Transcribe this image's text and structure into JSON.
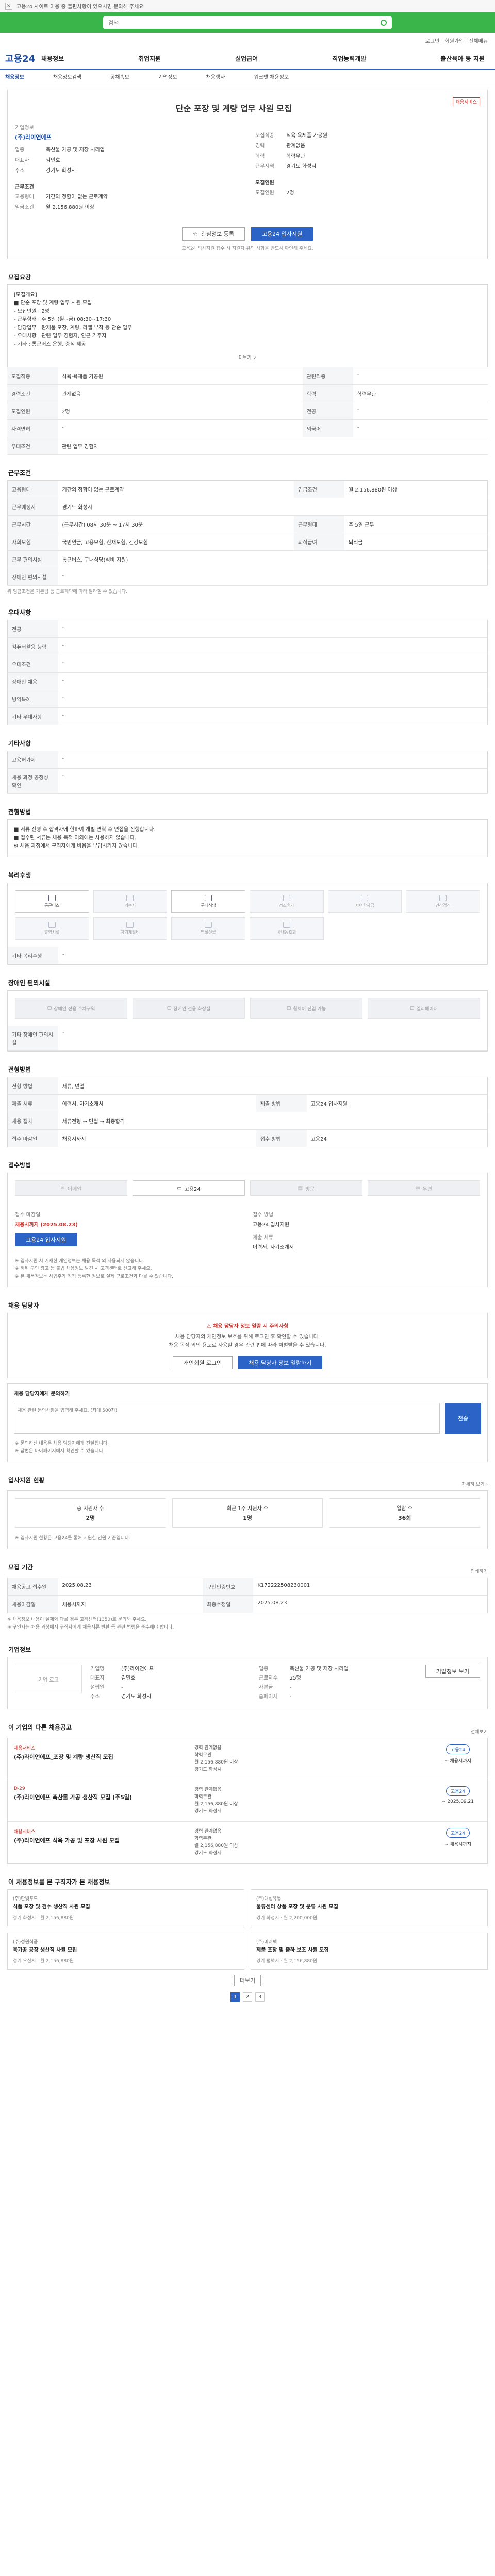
{
  "topbar": {
    "close": "×",
    "notice": "고용24 사이트 이용 중 불편사항이 있으시면 문의해 주세요"
  },
  "search": {
    "placeholder": "검색",
    "button": "검색"
  },
  "utility": [
    "로그인",
    "회원가입",
    "전체메뉴"
  ],
  "brand": "고용24",
  "gnb": [
    "채용정보",
    "취업지원",
    "실업급여",
    "직업능력개발",
    "출산육아 등 지원"
  ],
  "lnb": [
    "채용정보",
    "채용정보검색",
    "공채속보",
    "기업정보",
    "채용행사",
    "워크넷 채용정보"
  ],
  "job": {
    "badge": "채용서비스",
    "title": "단순 포장 및 계량 업무 사원 모집",
    "company_label": "기업정보",
    "company_name": "(주)라이언에프",
    "left": [
      {
        "k": "업종",
        "v": "축산물 가공 및 저장 처리업"
      },
      {
        "k": "대표자",
        "v": "김민호"
      },
      {
        "k": "주소",
        "v": "경기도 화성시"
      }
    ],
    "right": [
      {
        "k": "모집직종",
        "v": "식육·육제품 가공원"
      },
      {
        "k": "경력",
        "v": "관계없음"
      },
      {
        "k": "학력",
        "v": "학력무관"
      },
      {
        "k": "근무지역",
        "v": "경기도 화성시"
      }
    ],
    "cond_label": "근무조건",
    "cond": [
      {
        "k": "고용형태",
        "v": "기간의 정함이 없는 근로계약"
      },
      {
        "k": "임금조건",
        "v": "월 2,156,880원 이상"
      }
    ],
    "hire_label": "모집인원",
    "hire": [
      {
        "k": "모집인원",
        "v": "2명"
      }
    ],
    "btn_save": "관심정보 등록",
    "btn_apply": "고용24 입사지원",
    "apply_note": "고용24 입사지원 접수 시 지원자 유의 사항을 반드시 확인해 주세요."
  },
  "detail": {
    "title": "모집요강",
    "desc": [
      "[모집개요]",
      "■ 단순 포장 및 계량 업무 사원 모집",
      "- 모집인원 : 2명",
      "- 근무형태 : 주 5일 (월~금) 08:30~17:30",
      "- 담당업무 : 완제품 포장, 계량, 라벨 부착 등 단순 업무",
      "- 우대사항 : 관련 업무 경험자, 인근 거주자",
      "- 기타 : 통근버스 운행, 중식 제공"
    ],
    "more": "더보기 ∨",
    "rows": [
      {
        "k": "모집직종",
        "v": "식육·육제품 가공원",
        "k2": "관련직종",
        "v2": "-"
      },
      {
        "k": "경력조건",
        "v": "관계없음",
        "k2": "학력",
        "v2": "학력무관"
      },
      {
        "k": "모집인원",
        "v": "2명",
        "k2": "전공",
        "v2": "-"
      },
      {
        "k": "자격면허",
        "v": "-",
        "k2": "외국어",
        "v2": "-"
      },
      {
        "k": "우대조건",
        "v": "관련 업무 경험자",
        "k2": "",
        "v2": ""
      }
    ]
  },
  "work": {
    "title": "근무조건",
    "rows": [
      {
        "k": "고용형태",
        "v": "기간의 정함이 없는 근로계약",
        "k2": "임금조건",
        "v2": "월 2,156,880원 이상"
      },
      {
        "k": "근무예정지",
        "v": "경기도 화성시",
        "k2": "",
        "v2": ""
      },
      {
        "k": "근무시간",
        "v": "(근무시간) 08시 30분 ~ 17시 30분",
        "k2": "근무형태",
        "v2": "주 5일 근무"
      },
      {
        "k": "사회보험",
        "v": "국민연금, 고용보험, 산재보험, 건강보험",
        "k2": "퇴직급여",
        "v2": "퇴직금"
      },
      {
        "k": "근무 편의시설",
        "v": "통근버스, 구내식당(식비 지원)",
        "k2": "",
        "v2": ""
      },
      {
        "k": "장애인 편의시설",
        "v": "-",
        "k2": "",
        "v2": ""
      }
    ],
    "note": "위 임금조건은 기본급 등 근로계약에 따라 달라질 수 있습니다."
  },
  "welfare": {
    "title": "우대사항",
    "rows": [
      {
        "k": "전공",
        "v": "-"
      },
      {
        "k": "컴퓨터활용 능력",
        "v": "-"
      },
      {
        "k": "우대조건",
        "v": "-"
      },
      {
        "k": "장애인 채용",
        "v": "-"
      },
      {
        "k": "병역특례",
        "v": "-"
      },
      {
        "k": "기타 우대사항",
        "v": "-"
      }
    ]
  },
  "etc": {
    "title": "기타사항",
    "rows": [
      {
        "k": "고용허가제",
        "v": "-"
      },
      {
        "k": "채용 과정 공정성 확인",
        "v": "-"
      }
    ]
  },
  "process": {
    "title": "전형방법",
    "text": [
      "■ 서류 전형 후 합격자에 한하여 개별 연락 후 면접을 진행합니다.",
      "■ 접수된 서류는 채용 목적 이외에는 사용하지 않습니다.",
      "※ 채용 과정에서 구직자에게 비용을 부담시키지 않습니다."
    ]
  },
  "benefits": {
    "title": "복리후생",
    "items": [
      {
        "label": "통근버스",
        "on": true
      },
      {
        "label": "기숙사",
        "on": false
      },
      {
        "label": "구내식당",
        "on": true
      },
      {
        "label": "경조휴가",
        "on": false
      },
      {
        "label": "자녀학자금",
        "on": false
      },
      {
        "label": "건강검진",
        "on": false
      },
      {
        "label": "휴양시설",
        "on": false
      },
      {
        "label": "자기계발비",
        "on": false
      },
      {
        "label": "명절선물",
        "on": false
      },
      {
        "label": "사내동호회",
        "on": false
      }
    ],
    "other_k": "기타 복리후생",
    "other_v": "-"
  },
  "disability": {
    "title": "장애인 편의시설",
    "items": [
      "장애인 전용 주차구역",
      "장애인 전용 화장실",
      "휠체어 진입 가능",
      "엘리베이터"
    ],
    "other_k": "기타 장애인 편의시설",
    "other_v": "-"
  },
  "worktype": {
    "title": "전형방법",
    "rows": [
      {
        "k": "전형 방법",
        "v": "서류, 면접",
        "k2": "",
        "v2": ""
      },
      {
        "k": "제출 서류",
        "v": "이력서, 자기소개서",
        "k2": "제출 방법",
        "v2": "고용24 입사지원"
      },
      {
        "k": "채용 절차",
        "v": "서류전형 → 면접 → 최종합격",
        "k2": "",
        "v2": ""
      },
      {
        "k": "접수 마감일",
        "v": "채용시까지",
        "k2": "접수 방법",
        "v2": "고용24"
      }
    ]
  },
  "apply_method": {
    "title": "접수방법",
    "items": [
      {
        "label": "이메일",
        "on": false
      },
      {
        "label": "고용24",
        "on": true
      },
      {
        "label": "방문",
        "on": false
      },
      {
        "label": "우편",
        "on": false
      }
    ]
  },
  "apply_info": {
    "k1": "접수 마감일",
    "v1": "채용시까지 (2025.08.23)",
    "btn": "고용24 입사지원",
    "k2": "접수 방법",
    "v2": "고용24 입사지원",
    "k3": "제출 서류",
    "v3": "이력서, 자기소개서",
    "notes": [
      "※ 입사지원 시 기재한 개인정보는 채용 목적 외 사용되지 않습니다.",
      "※ 허위 구인 광고 등 불법 채용정보 발견 시 고객센터로 신고해 주세요.",
      "※ 본 채용정보는 사업주가 직접 등록한 정보로 실제 근로조건과 다를 수 있습니다."
    ]
  },
  "contact": {
    "title": "채용 담당자",
    "warn": "채용 담당자 정보 열람 시 주의사항",
    "text": [
      "채용 담당자의 개인정보 보호를 위해 로그인 후 확인할 수 있습니다.",
      "채용 목적 외의 용도로 사용할 경우 관련 법에 따라 처벌받을 수 있습니다."
    ],
    "btn1": "개인회원 로그인",
    "btn2": "채용 담당자 정보 열람하기"
  },
  "inquiry": {
    "label": "채용 담당자에게 문의하기",
    "placeholder": "채용 관련 문의사항을 입력해 주세요. (최대 500자)",
    "send": "전송",
    "notes": [
      "※ 문의하신 내용은 채용 담당자에게 전달됩니다.",
      "※ 답변은 마이페이지에서 확인할 수 있습니다."
    ]
  },
  "stats": {
    "title": "입사지원 현황",
    "aside": "자세히 보기 ›",
    "items": [
      {
        "k": "총 지원자 수",
        "v": "2명"
      },
      {
        "k": "최근 1주 지원자 수",
        "v": "1명"
      },
      {
        "k": "열람 수",
        "v": "36회"
      }
    ],
    "note": "※ 입사지원 현황은 고용24를 통해 지원한 인원 기준입니다."
  },
  "period": {
    "title": "모집 기간",
    "aside": "인쇄하기",
    "rows": [
      {
        "k": "채용공고 접수일",
        "v": "2025.08.23",
        "k2": "구인인증번호",
        "v2": "K172222508230001"
      },
      {
        "k": "채용마감일",
        "v": "채용시까지",
        "k2": "최종수정일",
        "v2": "2025.08.23"
      }
    ],
    "notes": [
      "※ 채용정보 내용이 실제와 다를 경우 고객센터(1350)로 문의해 주세요.",
      "※ 구인자는 채용 과정에서 구직자에게 채용서류 반환 등 관련 법령을 준수해야 합니다."
    ]
  },
  "company": {
    "title": "기업정보",
    "logo": "기업 로고",
    "rows": [
      {
        "k": "기업명",
        "v": "(주)라이언에프"
      },
      {
        "k": "업종",
        "v": "축산물 가공 및 저장 처리업"
      },
      {
        "k": "대표자",
        "v": "김민호"
      },
      {
        "k": "근로자수",
        "v": "25명"
      },
      {
        "k": "설립일",
        "v": "-"
      },
      {
        "k": "자본금",
        "v": "-"
      },
      {
        "k": "주소",
        "v": "경기도 화성시"
      },
      {
        "k": "홈페이지",
        "v": "-"
      }
    ],
    "btn": "기업정보 보기"
  },
  "related": {
    "title": "이 기업의 다른 채용공고",
    "aside": "전체보기",
    "items": [
      {
        "tag": "채용서비스",
        "title": "(주)라이언에프_포장 및 계량 생산직 모집",
        "lines": [
          "경력 관계없음",
          "학력무관",
          "월 2,156,880원 이상",
          "경기도 화성시"
        ],
        "pill": "고용24",
        "date": "~ 채용시까지"
      },
      {
        "tag": "D-29",
        "title": "(주)라이언에프 축산물 가공 생산직 모집 (주5일)",
        "lines": [
          "경력 관계없음",
          "학력무관",
          "월 2,156,880원 이상",
          "경기도 화성시"
        ],
        "pill": "고용24",
        "date": "~ 2025.09.21"
      },
      {
        "tag": "채용서비스",
        "title": "(주)라이언에프 식육 가공 및 포장 사원 모집",
        "lines": [
          "경력 관계없음",
          "학력무관",
          "월 2,156,880원 이상",
          "경기도 화성시"
        ],
        "pill": "고용24",
        "date": "~ 채용시까지"
      }
    ]
  },
  "recommend": {
    "title": "이 채용정보를 본 구직자가 본 채용정보",
    "cards": [
      {
        "co": "(주)한빛푸드",
        "t": "식품 포장 및 검수 생산직 사원 모집",
        "m": "경기 화성시 · 월 2,156,880원"
      },
      {
        "co": "(주)대성유통",
        "t": "물류센터 상품 포장 및 분류 사원 모집",
        "m": "경기 화성시 · 월 2,200,000원"
      },
      {
        "co": "(주)성원식품",
        "t": "육가공 공장 생산직 사원 모집",
        "m": "경기 오산시 · 월 2,156,880원"
      },
      {
        "co": "(주)미래팩",
        "t": "제품 포장 및 출하 보조 사원 모집",
        "m": "경기 평택시 · 월 2,156,880원"
      }
    ],
    "more": "더보기",
    "pages": [
      "1",
      "2",
      "3"
    ]
  }
}
